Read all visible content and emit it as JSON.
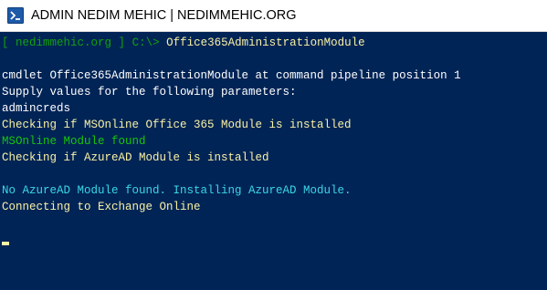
{
  "window": {
    "title": "ADMIN NEDIM MEHIC | NEDIMMEHIC.ORG",
    "icon": "terminal-icon",
    "background_color": "#012456"
  },
  "console": {
    "prompt": {
      "open_bracket": "[ ",
      "host": "nedimmehic.org",
      "close_bracket": " ]",
      "path": " C:\\>",
      "command": " Office365AdministrationModule"
    },
    "lines": [
      {
        "text": "",
        "color": "#cccccc"
      },
      {
        "text": "cmdlet Office365AdministrationModule at command pipeline position 1",
        "color": "#ffffff"
      },
      {
        "text": "Supply values for the following parameters:",
        "color": "#ffffff"
      },
      {
        "text": "admincreds",
        "color": "#ffffff"
      },
      {
        "text": "Checking if MSOnline Office 365 Module is installed",
        "color": "#f9f1a5"
      },
      {
        "text": "MSOnline Module found",
        "color": "#16c60c"
      },
      {
        "text": "Checking if AzureAD Module is installed",
        "color": "#f9f1a5"
      },
      {
        "text": "",
        "color": "#cccccc"
      },
      {
        "text": "No AzureAD Module found. Installing AzureAD Module.",
        "color": "#3ad7e6"
      },
      {
        "text": "Connecting to Exchange Online",
        "color": "#f9f1a5"
      },
      {
        "text": "",
        "color": "#cccccc"
      }
    ],
    "cursor_color": "#f9f1a5"
  }
}
